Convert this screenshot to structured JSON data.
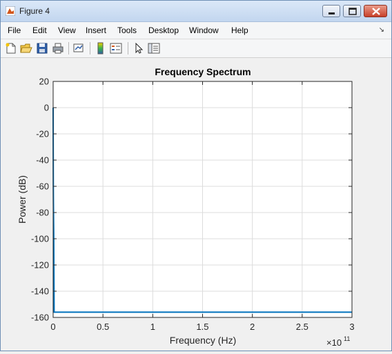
{
  "window": {
    "title": "Figure 4"
  },
  "menu": {
    "items": [
      "File",
      "Edit",
      "View",
      "Insert",
      "Tools",
      "Desktop",
      "Window",
      "Help"
    ],
    "overflow_arrow": "↘"
  },
  "toolbar": {
    "buttons": [
      "new-figure-icon",
      "open-file-icon",
      "save-icon",
      "print-icon",
      "link-plot-icon",
      "colorbar-icon",
      "legend-icon",
      "pointer-icon",
      "property-editor-icon"
    ]
  },
  "colors": {
    "line": "#0072bd",
    "axes_bg": "#ffffff",
    "grid": "#dcdcdc"
  },
  "chart_data": {
    "type": "line",
    "title": "Frequency Spectrum",
    "xlabel": "Frequency (Hz)",
    "ylabel": "Power (dB)",
    "x_exponent_label": "×10",
    "x_exponent": "11",
    "xlim": [
      0,
      3
    ],
    "ylim": [
      -160,
      20
    ],
    "xticks": [
      "0",
      "0.5",
      "1",
      "1.5",
      "2",
      "2.5",
      "3"
    ],
    "xtick_values": [
      0,
      0.5,
      1,
      1.5,
      2,
      2.5,
      3
    ],
    "yticks": [
      "20",
      "0",
      "-20",
      "-40",
      "-60",
      "-80",
      "-100",
      "-120",
      "-140",
      "-160"
    ],
    "ytick_values": [
      20,
      0,
      -20,
      -40,
      -60,
      -80,
      -100,
      -120,
      -140,
      -160
    ],
    "grid": true,
    "series": [
      {
        "x": [
          0,
          0.0005,
          0.001,
          0.0015,
          0.002,
          0.003,
          0.004,
          0.005,
          0.006,
          0.01,
          0.1,
          0.5,
          1,
          1.5,
          2,
          2.5,
          3
        ],
        "y": [
          0,
          -15,
          -30,
          -48,
          -60,
          -72,
          -80,
          -88,
          -95,
          -156,
          -156,
          -156,
          -156,
          -156,
          -156,
          -156,
          -156
        ]
      }
    ]
  }
}
